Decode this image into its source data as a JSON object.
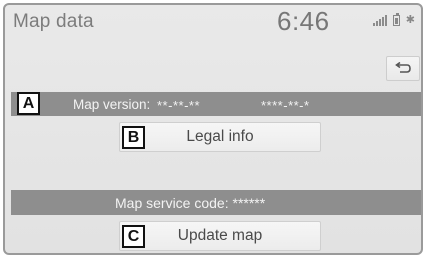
{
  "header": {
    "title": "Map data",
    "clock": "6:46",
    "status_icons": [
      "signal-icon",
      "battery-icon",
      "bluetooth-icon"
    ]
  },
  "toolbar": {
    "back_icon": "back-arrow-icon"
  },
  "map_version": {
    "marker": "A",
    "label": "Map version:",
    "value_1": "**-**-**",
    "value_2": "****-**-*"
  },
  "legal_info": {
    "marker": "B",
    "label": "Legal info"
  },
  "map_service": {
    "label": "Map service code: ******"
  },
  "update_map": {
    "marker": "C",
    "label": "Update map"
  },
  "colors": {
    "background": "#e6e6e6",
    "bar": "#8e8e8e",
    "button": "#f2f2f2",
    "text_dark": "#4a4a4a"
  }
}
